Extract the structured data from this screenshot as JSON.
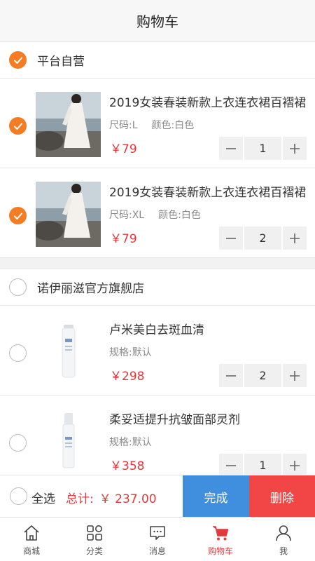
{
  "header": {
    "title": "购物车"
  },
  "stores": [
    {
      "name": "平台自营",
      "checked": true,
      "items": [
        {
          "name": "2019女装春装新款上衣连衣裙百褶裙",
          "spec1": "尺码:L",
          "spec2": "颜色:白色",
          "price": "￥79",
          "qty": "1",
          "checked": true
        },
        {
          "name": "2019女装春装新款上衣连衣裙百褶裙",
          "spec1": "尺码:XL",
          "spec2": "颜色:白色",
          "price": "￥79",
          "qty": "2",
          "checked": true
        }
      ]
    },
    {
      "name": "诺伊丽滋官方旗舰店",
      "checked": false,
      "items": [
        {
          "name": "卢米美白去斑血清",
          "spec1": "规格:默认",
          "price": "￥298",
          "qty": "2",
          "checked": false
        },
        {
          "name": "柔妥适提升抗皱面部灵剂",
          "spec1": "规格:默认",
          "price": "￥358",
          "qty": "1",
          "checked": false
        }
      ]
    }
  ],
  "footer": {
    "select_all": "全选",
    "total_label": "总计:",
    "total_value": "￥ 237.00",
    "done": "完成",
    "delete": "删除"
  },
  "tabbar": [
    {
      "label": "商城",
      "icon": "home-icon"
    },
    {
      "label": "分类",
      "icon": "category-icon"
    },
    {
      "label": "消息",
      "icon": "message-icon"
    },
    {
      "label": "购物车",
      "icon": "cart-icon",
      "active": true
    },
    {
      "label": "我",
      "icon": "user-icon"
    }
  ],
  "colors": {
    "accent": "#f57c22",
    "price": "#e4393c",
    "done": "#3f8fde",
    "delete": "#f24646"
  }
}
